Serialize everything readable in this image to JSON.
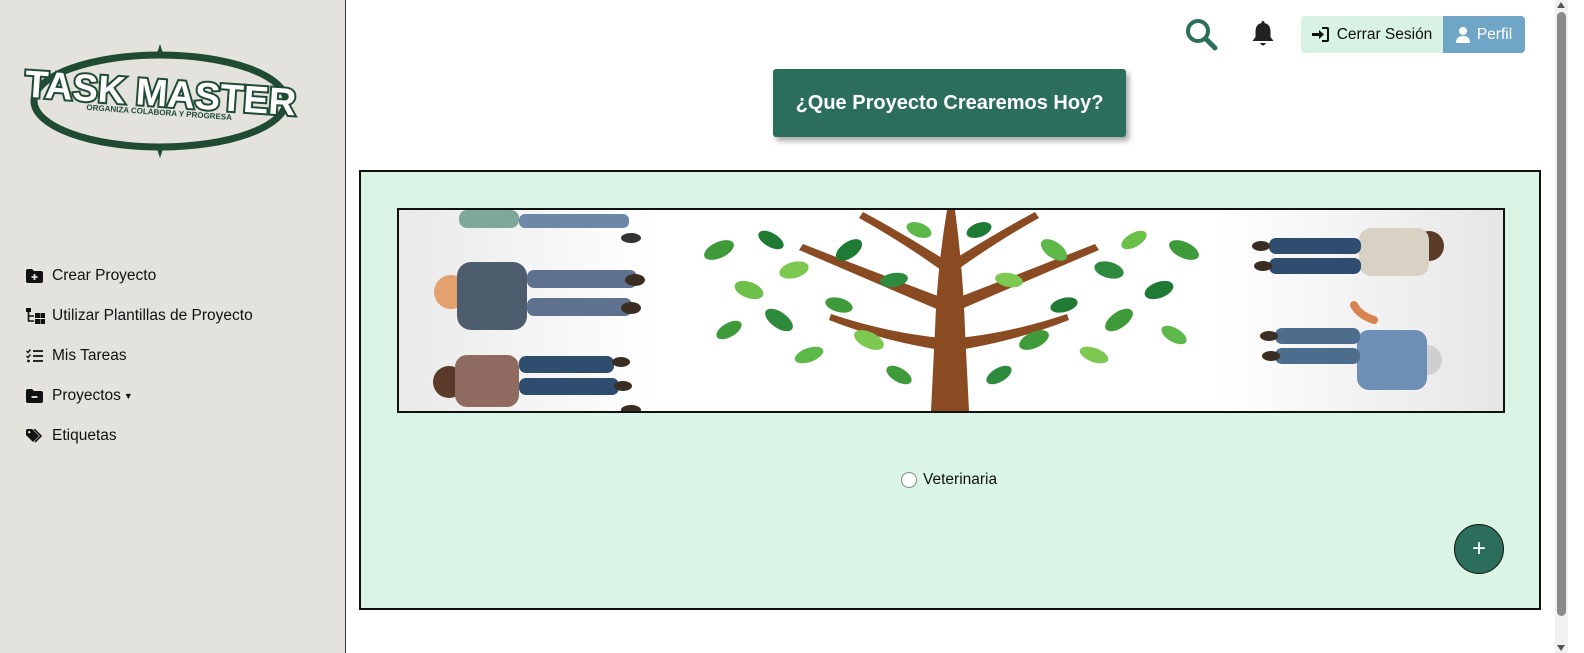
{
  "brand": {
    "logo_title": "TASK MASTER",
    "logo_tagline": "ORGANIZA COLABORA Y PROGRESA"
  },
  "sidebar": {
    "items": [
      {
        "label": "Crear Proyecto",
        "icon": "folder-plus-icon"
      },
      {
        "label": "Utilizar Plantillas de Proyecto",
        "icon": "template-tree-icon"
      },
      {
        "label": "Mis Tareas",
        "icon": "task-list-icon"
      },
      {
        "label": "Proyectos",
        "icon": "folder-minus-icon",
        "dropdown": true
      },
      {
        "label": "Etiquetas",
        "icon": "tags-icon"
      }
    ]
  },
  "topbar": {
    "search_icon": "search-icon",
    "notifications_icon": "bell-icon",
    "logout_label": "Cerrar Sesión",
    "profile_label": "Perfil"
  },
  "main": {
    "headline": "¿Que Proyecto Crearemos Hoy?",
    "banner_image": "people-around-tree-illustration",
    "projects": [
      {
        "label": "Veterinaria",
        "selected": false
      }
    ],
    "add_button_label": "+"
  },
  "colors": {
    "primary": "#2c6e5c",
    "sidebar_bg": "#e3e2dd",
    "panel_bg": "#daf4e5",
    "logout_bg": "#d8f2e3",
    "profile_bg": "#6fa6c6"
  }
}
